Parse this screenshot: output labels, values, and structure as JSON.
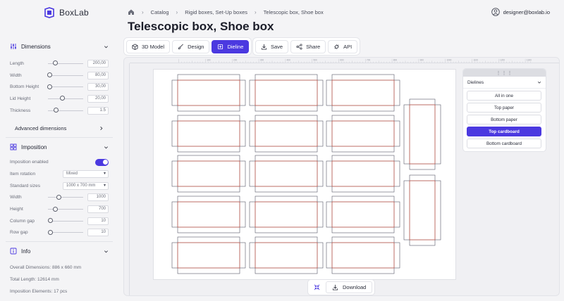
{
  "app": {
    "logo_text": "BoxLab"
  },
  "breadcrumb": [
    "Catalog",
    "Rigid boxes, Set-Up boxes",
    "Telescopic box, Shoe box"
  ],
  "user": {
    "email": "designer@boxlab.io"
  },
  "page_title": "Telescopic box, Shoe box",
  "toolbar": {
    "tabs": [
      {
        "label": "3D Model",
        "icon": "cube-icon",
        "active": false
      },
      {
        "label": "Design",
        "icon": "brush-icon",
        "active": false
      },
      {
        "label": "Dieline",
        "icon": "dieline-icon",
        "active": true
      }
    ],
    "actions": [
      {
        "label": "Save",
        "icon": "download-icon"
      },
      {
        "label": "Share",
        "icon": "share-icon"
      },
      {
        "label": "API",
        "icon": "api-icon"
      }
    ]
  },
  "dimensions": {
    "title": "Dimensions",
    "fields": [
      {
        "label": "Length",
        "value": "200,00",
        "level": 0.2
      },
      {
        "label": "Width",
        "value": "80,00",
        "level": 0.05
      },
      {
        "label": "Bottom Height",
        "value": "30,00",
        "level": 0.05
      },
      {
        "label": "Lid Height",
        "value": "20,00",
        "level": 0.4
      },
      {
        "label": "Thickness",
        "value": "1.5",
        "level": 0.22
      }
    ],
    "advanced_label": "Advanced dimensions"
  },
  "imposition": {
    "title": "Imposition",
    "enabled_label": "Imposition enabled",
    "enabled": true,
    "rotation_label": "Item rotation",
    "rotation_value": "Mixed",
    "sizes_label": "Standard sizes",
    "sizes_value": "1000 x 700 mm",
    "fields": [
      {
        "label": "Width",
        "value": "1000",
        "level": 0.3
      },
      {
        "label": "Height",
        "value": "700",
        "level": 0.2
      },
      {
        "label": "Column gap",
        "value": "10",
        "level": 0.06
      },
      {
        "label": "Row gap",
        "value": "10",
        "level": 0.06
      }
    ]
  },
  "info": {
    "title": "Info",
    "rows": [
      {
        "label": "Overall Dimensions:",
        "value": "886 x 660 mm"
      },
      {
        "label": "Total Length:",
        "value": "12614 mm"
      },
      {
        "label": "Imposition Elements:",
        "value": "17 pcs"
      }
    ]
  },
  "ruler_labels": [
    "100",
    "200",
    "300",
    "400",
    "500",
    "600",
    "700",
    "800",
    "900",
    "1000",
    "1100",
    "1200",
    "1300"
  ],
  "dielines_panel": {
    "title": "Dielines",
    "options": [
      {
        "label": "All in one",
        "active": false
      },
      {
        "label": "Top paper",
        "active": false
      },
      {
        "label": "Bottom paper",
        "active": false
      },
      {
        "label": "Top cardboard",
        "active": true
      },
      {
        "label": "Bottom cardboard",
        "active": false
      }
    ]
  },
  "bottom_bar": {
    "download_label": "Download"
  },
  "colors": {
    "accent": "#4b39e0",
    "cut_line": "#d84f3f",
    "fold_line": "#555866"
  }
}
